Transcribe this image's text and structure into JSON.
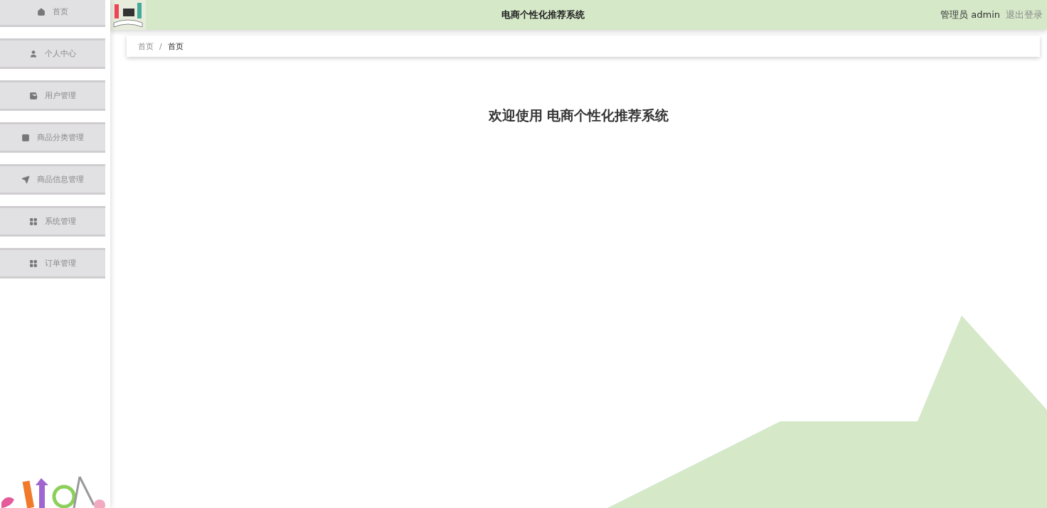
{
  "header": {
    "title": "电商个性化推荐系统",
    "user": "管理员 admin",
    "logout": "退出登录"
  },
  "sidebar": {
    "items": [
      {
        "label": "首页"
      },
      {
        "label": "个人中心"
      },
      {
        "label": "用户管理"
      },
      {
        "label": "商品分类管理"
      },
      {
        "label": "商品信息管理"
      },
      {
        "label": "系统管理"
      },
      {
        "label": "订单管理"
      }
    ]
  },
  "breadcrumb": [
    {
      "label": "首页",
      "current": false
    },
    {
      "label": "首页",
      "current": true
    }
  ],
  "breadcrumb_separator": "/",
  "welcome": {
    "title": "欢迎使用 电商个性化推荐系统"
  }
}
